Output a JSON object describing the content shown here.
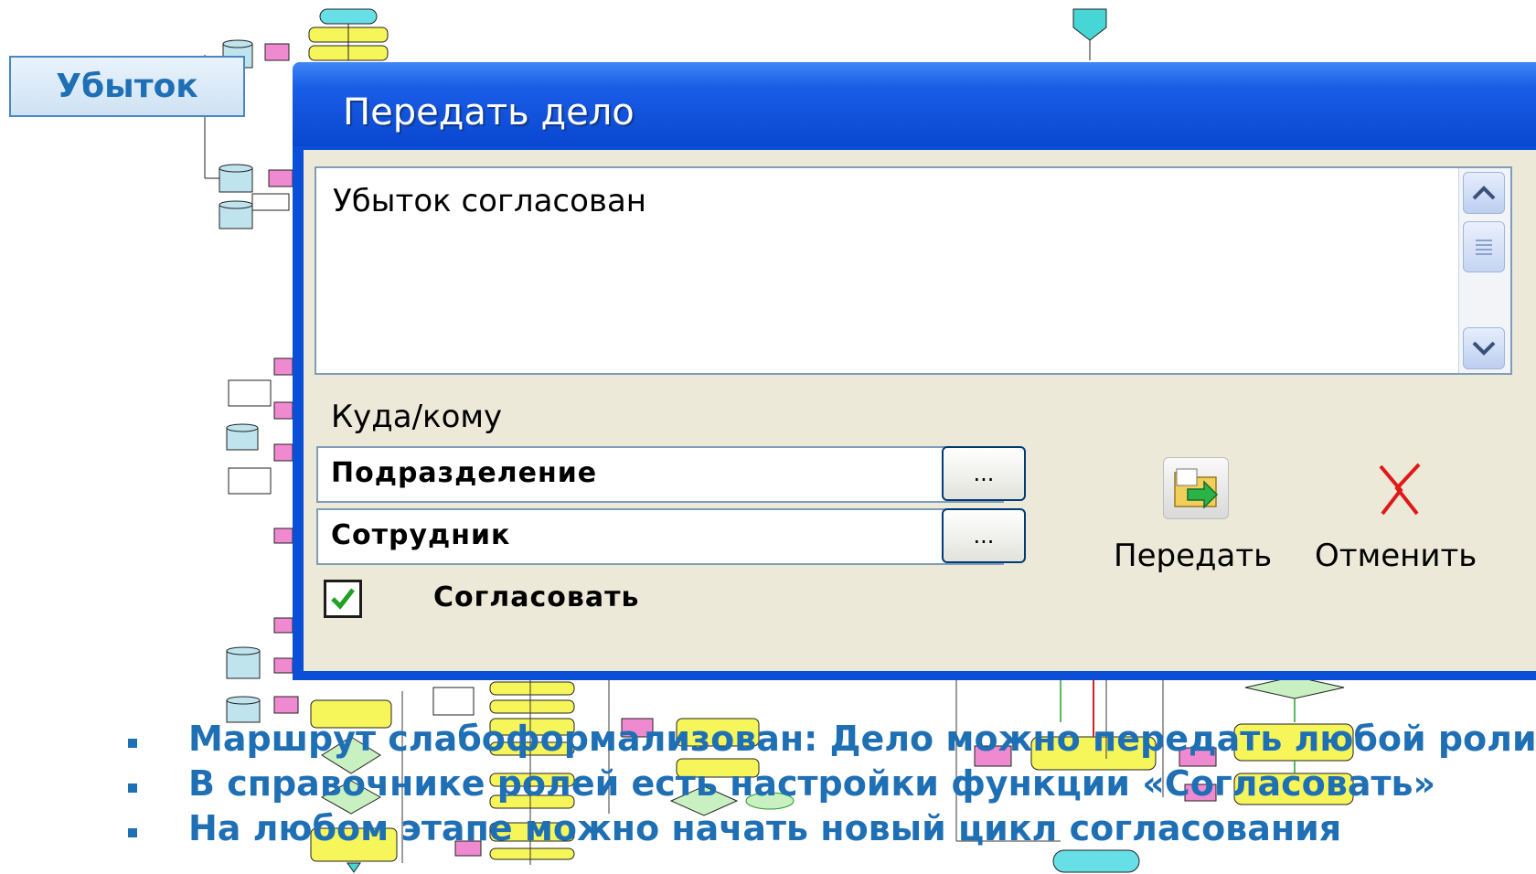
{
  "label_box": {
    "text": "Убыток"
  },
  "dialog": {
    "title": "Передать дело",
    "comment": "Убыток согласован",
    "destination_label": "Куда/кому",
    "fields": [
      {
        "value": "Подразделение",
        "button": "..."
      },
      {
        "value": "Сотрудник",
        "button": "..."
      }
    ],
    "checkbox": {
      "label": "Согласовать",
      "checked": true
    },
    "send_label": "Передать",
    "cancel_label": "Отменить"
  },
  "bullets": [
    "Маршрут слабоформализован: Дело можно передать любой  роли",
    "В справочнике ролей есть настройки функции «Согласовать»",
    "На любом этапе можно начать новый цикл согласования"
  ],
  "colors": {
    "accent": "#1f6fb5",
    "dialog_blue": "#0a4fd6",
    "dialog_body": "#ece9d8"
  }
}
